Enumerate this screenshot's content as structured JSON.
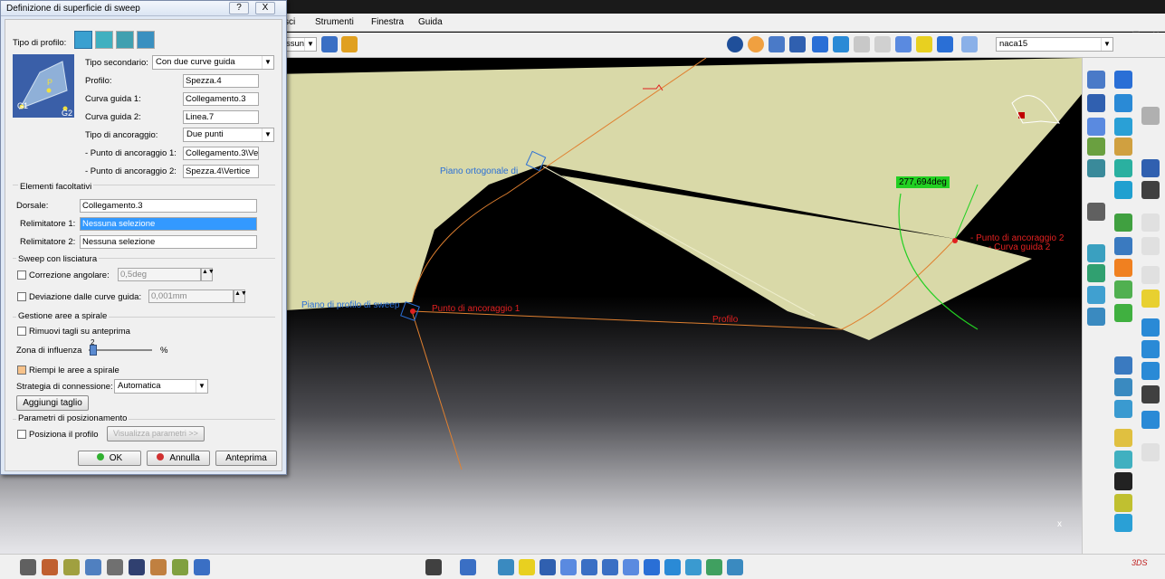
{
  "menubar": {
    "items": [
      "sci",
      "Strumenti",
      "Finestra",
      "Guida"
    ]
  },
  "toolbar_top": {
    "combo_left": "ssuno",
    "combo_right": "naca15"
  },
  "dialog": {
    "title": "Definizione di superficie di sweep",
    "help_btn": "?",
    "close_btn": "X",
    "profile_type_label": "Tipo di profilo:",
    "preview_labels": [
      "P",
      "G1",
      "G2"
    ],
    "sub_type": {
      "label": "Tipo secondario:",
      "value": "Con due curve guida"
    },
    "profile": {
      "label": "Profilo:",
      "value": "Spezza.4"
    },
    "guide1": {
      "label": "Curva guida 1:",
      "value": "Collegamento.3"
    },
    "guide2": {
      "label": "Curva guida 2:",
      "value": "Linea.7"
    },
    "anchor_type": {
      "label": "Tipo di ancoraggio:",
      "value": "Due punti"
    },
    "anchor1": {
      "label": "- Punto di ancoraggio 1:",
      "value": "Collegamento.3\\Ve"
    },
    "anchor2": {
      "label": "- Punto di ancoraggio 2:",
      "value": "Spezza.4\\Vertice"
    },
    "optional_title": "Elementi facoltativi",
    "spine": {
      "label": "Dorsale:",
      "value": "Collegamento.3"
    },
    "relim1": {
      "label": "Relimitatore 1:",
      "value": "Nessuna selezione"
    },
    "relim2": {
      "label": "Relimitatore 2:",
      "value": "Nessuna selezione"
    },
    "sweep_title": "Sweep con lisciatura",
    "angular": {
      "label": "Correzione angolare:",
      "value": "0,5deg"
    },
    "deviation": {
      "label": "Deviazione dalle curve guida:",
      "value": "0,001mm"
    },
    "spiral_title": "Gestione aree a spirale",
    "remove_cuts": "Rimuovi tagli su anteprima",
    "influence": {
      "label": "Zona di influenza",
      "value": "2",
      "unit": "%"
    },
    "fill_spiral": "Riempi le aree a spirale",
    "connection": {
      "label": "Strategia di connessione:",
      "value": "Automatica"
    },
    "add_cut": "Aggiungi taglio",
    "position_title": "Parametri di posizionamento",
    "position_profile": "Posiziona il profilo",
    "show_params": "Visualizza parametri >>",
    "ok": "OK",
    "cancel": "Annulla",
    "preview": "Anteprima"
  },
  "viewport": {
    "label_plane_top": "Piano ortogonale di",
    "label_plane_profile": "Piano di profilo di sweep",
    "label_anchor1": "Punto di ancoraggio 1",
    "label_anchor2": "- Punto di ancoraggio 2",
    "label_guide2": "- Curva guida 2",
    "label_profile": "Profilo",
    "angle": "277,694deg",
    "axis_label": "x"
  },
  "colors": {
    "surface": "#d9d9a8",
    "accent_red": "#e02020",
    "accent_blue": "#2a6fd6",
    "angle_green": "#22d022"
  }
}
